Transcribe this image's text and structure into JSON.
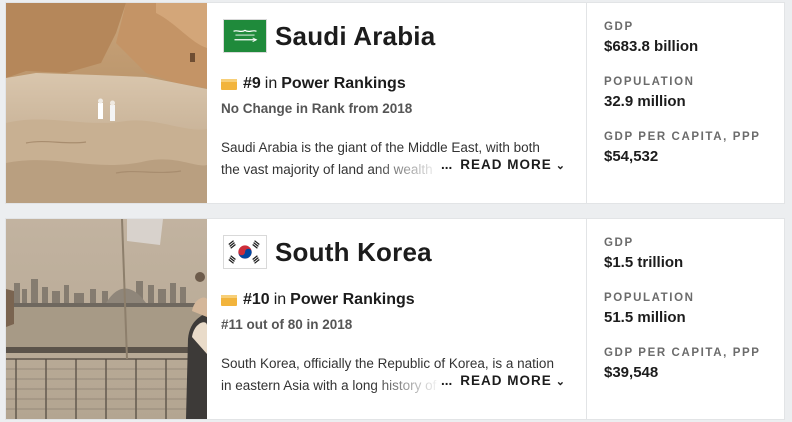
{
  "cards": [
    {
      "country": "Saudi Arabia",
      "flag": "saudi-flag",
      "rank_number": "#9",
      "rank_in": "in",
      "rank_label": "Power Rankings",
      "rank_change": "No Change in Rank from 2018",
      "description_line1": "Saudi Arabia is the giant of the Middle East, with both",
      "description_line2": "the vast majority of land and wealth",
      "read_more_dots": "...",
      "read_more": "READ MORE",
      "stats": {
        "gdp_label": "GDP",
        "gdp_value": "$683.8 billion",
        "population_label": "POPULATION",
        "population_value": "32.9 million",
        "gdp_ppp_label": "GDP PER CAPITA, PPP",
        "gdp_ppp_value": "$54,532"
      }
    },
    {
      "country": "South Korea",
      "flag": "south-korea-flag",
      "rank_number": "#10",
      "rank_in": "in",
      "rank_label": "Power Rankings",
      "rank_change": "#11 out of 80 in 2018",
      "description_line1": "South Korea, officially the Republic of Korea, is a nation",
      "description_line2": "in eastern Asia with a long history of",
      "read_more_dots": "...",
      "read_more": "READ MORE",
      "stats": {
        "gdp_label": "GDP",
        "gdp_value": "$1.5 trillion",
        "population_label": "POPULATION",
        "population_value": "51.5 million",
        "gdp_ppp_label": "GDP PER CAPITA, PPP",
        "gdp_ppp_value": "$39,548"
      }
    }
  ],
  "colors": {
    "accent_trophy": "#f2b43c",
    "saudi_green": "#1f8a3b",
    "korea_red": "#cd2e3a",
    "korea_blue": "#0047a0"
  }
}
